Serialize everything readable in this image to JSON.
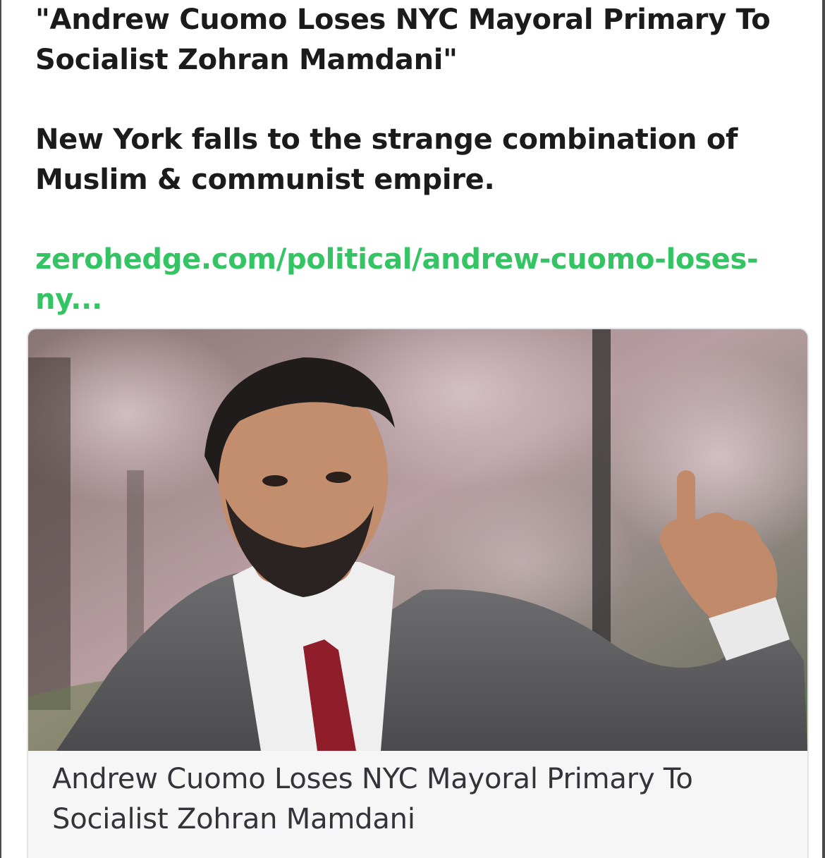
{
  "post": {
    "headline_quote": "\"Andrew Cuomo Loses NYC Mayoral Primary To Socialist Zohran Mamdani\"",
    "comment": "New York falls to the strange combination of Muslim & communist empire.",
    "link_text": "zerohedge.com/political/andrew-cuomo-loses-ny..."
  },
  "link_card": {
    "image_icon": "photo",
    "title": "Andrew Cuomo Loses NYC Mayoral Primary To Socialist Zohran Mamdani"
  },
  "colors": {
    "text": "#1b1b1b",
    "link": "#34c463",
    "card_background": "#f6f6f7",
    "card_title": "#333338"
  }
}
